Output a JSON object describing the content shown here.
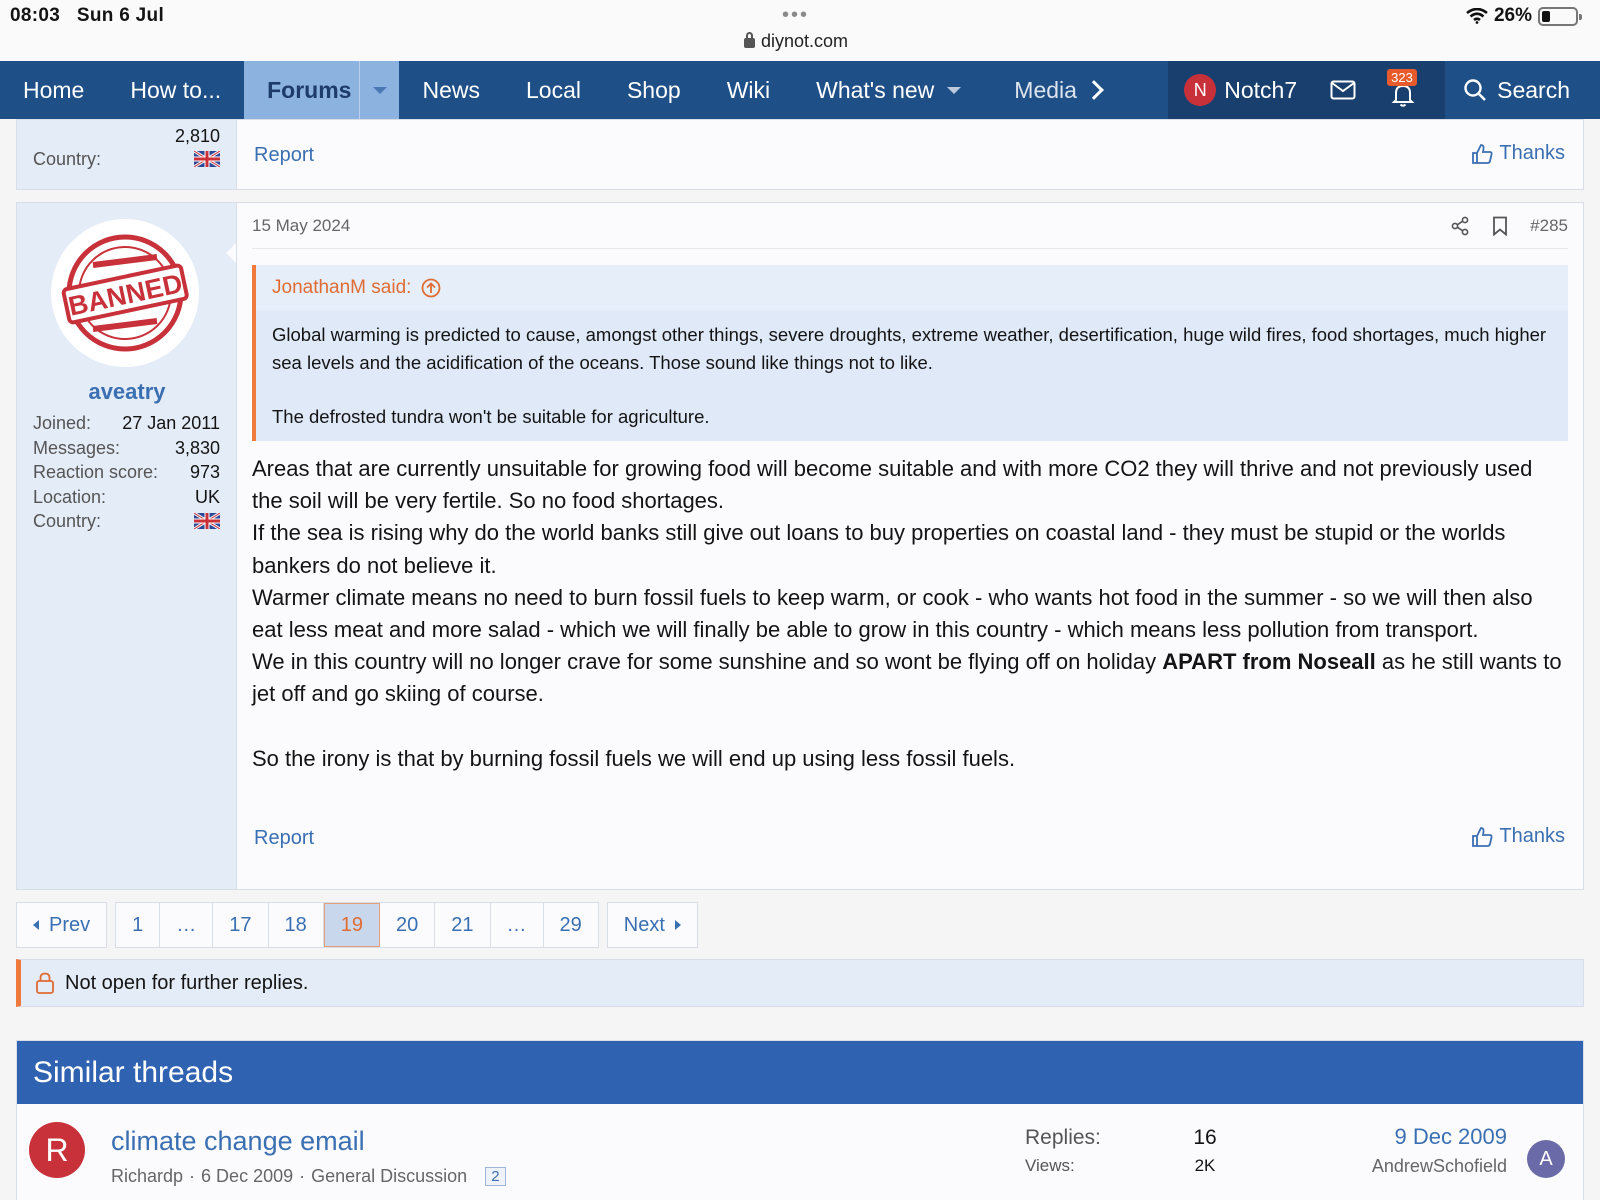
{
  "status_bar": {
    "time": "08:03",
    "date": "Sun 6 Jul",
    "url": "diynot.com",
    "battery": "26%",
    "battery_level": 0.26
  },
  "nav": {
    "items": [
      "Home",
      "How to...",
      "Forums",
      "News",
      "Local",
      "Shop",
      "Wiki",
      "What's new",
      "Media"
    ],
    "user": "Notch7",
    "user_initial": "N",
    "alerts_count": "323",
    "search": "Search"
  },
  "prev_post": {
    "count_value": "2,810",
    "country_label": "Country:",
    "report": "Report",
    "thanks": "Thanks"
  },
  "post": {
    "date": "15 May 2024",
    "number": "#285",
    "username": "aveatry",
    "avatar_text": "BANNED",
    "stats": [
      {
        "label": "Joined:",
        "value": "27 Jan 2011"
      },
      {
        "label": "Messages:",
        "value": "3,830"
      },
      {
        "label": "Reaction score:",
        "value": "973"
      },
      {
        "label": "Location:",
        "value": "UK"
      }
    ],
    "country_label": "Country:",
    "quote_author": "JonathanM said:",
    "quote_p1": "Global warming is predicted to cause, amongst other things, severe droughts, extreme weather, desertification, huge wild fires, food shortages, much higher sea levels and the acidification of the oceans. Those sound like things not to like.",
    "quote_p2": "The defrosted tundra won't be suitable for agriculture.",
    "body_1": "Areas that are currently unsuitable for growing food will become suitable and with more CO2 they will thrive and not previously used the soil will be very fertile. So no food shortages.",
    "body_2": "If the sea is rising why do the world banks still give out loans to buy properties on coastal land - they must be stupid or the worlds bankers do not believe it.",
    "body_3": "Warmer climate means no need to burn fossil fuels to keep warm, or cook - who wants hot food in the summer - so we will then also eat less meat and more salad - which we will finally be able to grow in this country - which means less pollution from transport.",
    "body_4a": "We in this country will no longer crave for some sunshine and so wont be flying off on holiday ",
    "body_4b": "APART from Noseall",
    "body_4c": " as he still wants to jet off and go skiing of course.",
    "body_5": "So the irony is that by burning fossil fuels we will end up using less fossil fuels.",
    "report": "Report",
    "thanks": "Thanks"
  },
  "pagination": {
    "prev": "Prev",
    "pages": [
      "1",
      "…",
      "17",
      "18",
      "19",
      "20",
      "21",
      "…",
      "29"
    ],
    "current": "19",
    "next": "Next"
  },
  "notice": "Not open for further replies.",
  "similar": {
    "heading": "Similar threads",
    "thread": {
      "avatar_initial": "R",
      "title": "climate change email",
      "author": "Richardp",
      "date": "6 Dec 2009",
      "forum": "General Discussion",
      "pages": "2",
      "replies_label": "Replies:",
      "replies": "16",
      "views_label": "Views:",
      "views": "2K",
      "last_date": "9 Dec 2009",
      "last_user": "AndrewSchofield",
      "last_initial": "A"
    }
  },
  "colors": {
    "nav_bg": "#1f4f87",
    "accent": "#3a6fb2",
    "quote_border": "#f07a3c",
    "banned_red": "#c8313a"
  }
}
